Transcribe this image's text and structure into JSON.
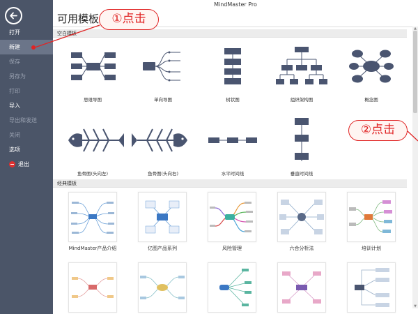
{
  "app": {
    "window_title": "MindMaster Pro",
    "page_title": "可用模板"
  },
  "sidebar": {
    "back_label": "←",
    "items": [
      {
        "label": "打开",
        "state": "normal"
      },
      {
        "label": "新建",
        "state": "active"
      },
      {
        "label": "保存",
        "state": "disabled"
      },
      {
        "label": "另存为",
        "state": "disabled"
      },
      {
        "label": "打印",
        "state": "disabled"
      },
      {
        "label": "导入",
        "state": "normal"
      },
      {
        "label": "导出和发送",
        "state": "disabled"
      },
      {
        "label": "关闭",
        "state": "disabled"
      },
      {
        "label": "选项",
        "state": "normal"
      },
      {
        "label": "退出",
        "state": "normal",
        "icon": "exit-icon"
      }
    ]
  },
  "sections": {
    "blank": {
      "title": "空白模板"
    },
    "classic": {
      "title": "经典模板"
    }
  },
  "blank_templates": [
    {
      "label": "思维导图",
      "icon": "mindmap-diagram"
    },
    {
      "label": "单向导图",
      "icon": "right-map-diagram"
    },
    {
      "label": "树状图",
      "icon": "tree-diagram"
    },
    {
      "label": "组织架构图",
      "icon": "org-chart-diagram"
    },
    {
      "label": "概念图",
      "icon": "concept-map-diagram"
    },
    {
      "label": "鱼骨图(头向左)",
      "icon": "fishbone-left-diagram"
    },
    {
      "label": "鱼骨图(头向右)",
      "icon": "fishbone-right-diagram"
    },
    {
      "label": "水平时间线",
      "icon": "horizontal-timeline-diagram"
    },
    {
      "label": "垂直时间线",
      "icon": "vertical-timeline-diagram"
    }
  ],
  "classic_templates": [
    {
      "label": "MindMaster产品介绍"
    },
    {
      "label": "亿图产品系列"
    },
    {
      "label": "风险管理"
    },
    {
      "label": "六合分析法"
    },
    {
      "label": "培训计划"
    },
    {
      "label": ""
    },
    {
      "label": ""
    },
    {
      "label": ""
    },
    {
      "label": ""
    },
    {
      "label": ""
    }
  ],
  "callouts": {
    "first": "①点击",
    "second": "②点击"
  },
  "colors": {
    "sidebar": "#4b5568",
    "node": "#4a5570",
    "callout": "#e02424"
  }
}
